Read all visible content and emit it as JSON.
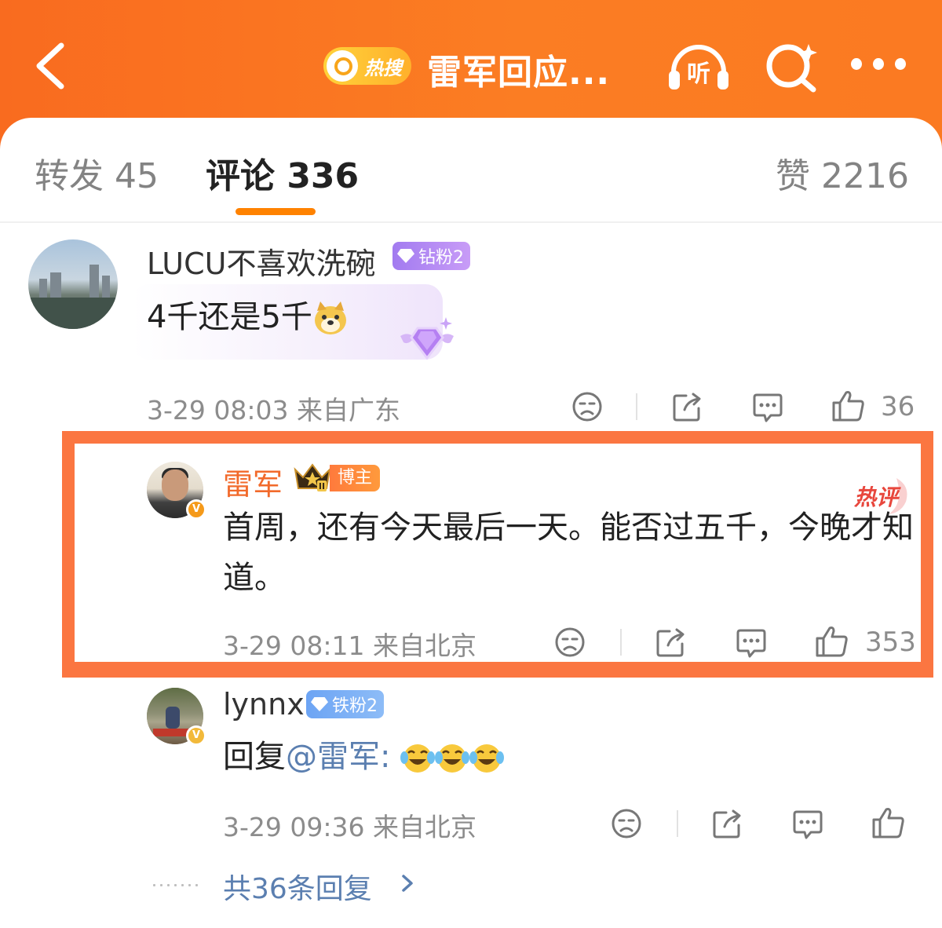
{
  "header": {
    "hot_badge_label": "热搜",
    "title": "雷军回应...",
    "icons": [
      "back-arrow-icon",
      "search-icon",
      "listen-icon",
      "search-sparkle-icon",
      "more-icon"
    ],
    "colors": {
      "header_gradient_start": "#f96b1f",
      "header_gradient_end": "#fb7a22",
      "hot_badge": "#ffc232"
    }
  },
  "tabs": {
    "forward": "转发 45",
    "comment": "评论 336",
    "like": "赞 2216",
    "active": "comment",
    "accent_color": "#ff8200"
  },
  "comments": [
    {
      "username": "LUCU不喜欢洗碗",
      "fan_badge": "钻粉2",
      "text": "4千还是5千",
      "emoji": "doge-emoji",
      "time_location": "3-29 08:03  来自广东",
      "like_count": "36"
    },
    {
      "username": "雷军",
      "role_badge": "博主",
      "crown_level": "II",
      "hot_mark": "热评",
      "text": "首周，还有今天最后一天。能否过五千，今晚才知道。",
      "time_location": "3-29 08:11  来自北京",
      "like_count": "353",
      "highlighted": true,
      "highlight_color": "#fb7641",
      "verified": "V"
    },
    {
      "username": "lynnx",
      "fan_badge": "铁粉2",
      "text_prefix": "回复",
      "mention": "@雷军",
      "text_suffix": ":",
      "emoji": "laugh-cry-emoji x3",
      "time_location": "3-29 09:36  来自北京",
      "like_count": "",
      "verified": "V"
    }
  ],
  "replies_link": "共36条回复"
}
